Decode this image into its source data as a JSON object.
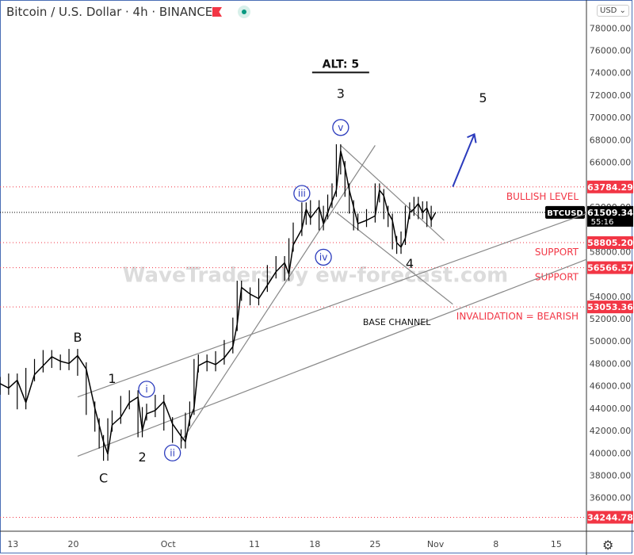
{
  "header": {
    "title": "Bitcoin / U.S. Dollar · 4h · BINANCE",
    "currency": "USD ⌄",
    "settings_icon": "gear-icon"
  },
  "watermark": "WaveTraders by ew-forecast.com",
  "chart_data": {
    "type": "line",
    "title": "Bitcoin / U.S. Dollar · 4h · BINANCE",
    "symbol": "BTCUSD",
    "last_price": "61509.34",
    "countdown": "55:16",
    "ylim": [
      33000,
      80500
    ],
    "yticks": [
      36000,
      38000,
      40000,
      42000,
      44000,
      46000,
      48000,
      50000,
      52000,
      54000,
      58000,
      62000,
      66000,
      68000,
      70000,
      72000,
      74000,
      76000,
      78000
    ],
    "xticks": [
      {
        "label": "13",
        "t": 0
      },
      {
        "label": "20",
        "t": 7
      },
      {
        "label": "Oct",
        "t": 18
      },
      {
        "label": "11",
        "t": 28
      },
      {
        "label": "18",
        "t": 35
      },
      {
        "label": "25",
        "t": 42
      },
      {
        "label": "Nov",
        "t": 49
      },
      {
        "label": "8",
        "t": 56
      },
      {
        "label": "15",
        "t": 63
      }
    ],
    "xlim": [
      -1.5,
      66.5
    ],
    "price_path": [
      [
        -1.5,
        46200
      ],
      [
        -0.5,
        45800
      ],
      [
        0.5,
        46500
      ],
      [
        1.5,
        44500
      ],
      [
        2.5,
        47000
      ],
      [
        3.5,
        47800
      ],
      [
        4.5,
        48600
      ],
      [
        5.5,
        48200
      ],
      [
        6.5,
        48000
      ],
      [
        7.5,
        48700
      ],
      [
        8.5,
        47500
      ],
      [
        9.5,
        44000
      ],
      [
        10,
        42500
      ],
      [
        10.5,
        41000
      ],
      [
        11,
        39900
      ],
      [
        11.5,
        42500
      ],
      [
        12.5,
        43200
      ],
      [
        13.5,
        44500
      ],
      [
        14.5,
        45000
      ],
      [
        15,
        42000
      ],
      [
        15.5,
        43500
      ],
      [
        16.5,
        43800
      ],
      [
        17.5,
        44600
      ],
      [
        18.5,
        42600
      ],
      [
        19.5,
        41500
      ],
      [
        20,
        41000
      ],
      [
        20.5,
        43000
      ],
      [
        21,
        44000
      ],
      [
        21.5,
        47800
      ],
      [
        22.5,
        48200
      ],
      [
        23.5,
        47900
      ],
      [
        24.5,
        48500
      ],
      [
        25.5,
        49500
      ],
      [
        26,
        51500
      ],
      [
        26.5,
        54800
      ],
      [
        27.5,
        54200
      ],
      [
        28.5,
        53800
      ],
      [
        29.5,
        55000
      ],
      [
        30.5,
        56200
      ],
      [
        31.5,
        57000
      ],
      [
        32,
        56000
      ],
      [
        32.5,
        58600
      ],
      [
        33.5,
        60000
      ],
      [
        34,
        61800
      ],
      [
        34.5,
        61000
      ],
      [
        35.5,
        62000
      ],
      [
        36,
        60500
      ],
      [
        36.5,
        61500
      ],
      [
        37,
        62500
      ],
      [
        37.5,
        63500
      ],
      [
        38,
        67000
      ],
      [
        38.5,
        65500
      ],
      [
        39,
        63500
      ],
      [
        39.5,
        62000
      ],
      [
        40,
        60500
      ],
      [
        41,
        60800
      ],
      [
        42,
        61200
      ],
      [
        42.5,
        63500
      ],
      [
        43,
        63000
      ],
      [
        43.5,
        61500
      ],
      [
        44,
        60800
      ],
      [
        44.5,
        58800
      ],
      [
        45,
        58400
      ],
      [
        45.5,
        59200
      ],
      [
        46,
        61500
      ],
      [
        46.5,
        61800
      ],
      [
        47,
        62300
      ],
      [
        47.5,
        61500
      ],
      [
        48,
        61900
      ],
      [
        48.5,
        60800
      ],
      [
        49,
        61500
      ]
    ],
    "levels": [
      {
        "value": 63784.29,
        "label": "BULLISH LEVEL"
      },
      {
        "value": 58805.2,
        "label": "SUPPORT"
      },
      {
        "value": 56566.57,
        "label": "SUPPORT"
      },
      {
        "value": 53053.36,
        "label": "INVALIDATION = BEARISH"
      },
      {
        "value": 34244.78,
        "label": ""
      }
    ],
    "last_price_value": 61509.34,
    "trendlines": [
      {
        "name": "channel-upper",
        "from": [
          7.5,
          45000
        ],
        "to": [
          66.5,
          61400
        ]
      },
      {
        "name": "base-channel",
        "from": [
          7.5,
          39700
        ],
        "to": [
          66.5,
          57300
        ]
      },
      {
        "name": "impulse-line",
        "from": [
          19.5,
          41000
        ],
        "to": [
          42,
          67500
        ]
      },
      {
        "name": "wedge-upper",
        "from": [
          38,
          67500
        ],
        "to": [
          50,
          59000
        ]
      },
      {
        "name": "wedge-lower",
        "from": [
          37.5,
          61500
        ],
        "to": [
          51,
          53300
        ]
      }
    ],
    "wave_labels": [
      {
        "text": "B",
        "t": 7.5,
        "v": 50300,
        "style": "plain"
      },
      {
        "text": "C",
        "t": 10.5,
        "v": 37700,
        "style": "plain"
      },
      {
        "text": "1",
        "t": 11.5,
        "v": 46600,
        "style": "plain"
      },
      {
        "text": "2",
        "t": 15,
        "v": 39600,
        "style": "plain"
      },
      {
        "text": "i",
        "t": 15.5,
        "v": 45700,
        "style": "circle"
      },
      {
        "text": "ii",
        "t": 18.5,
        "v": 40000,
        "style": "circle"
      },
      {
        "text": "iii",
        "t": 33.5,
        "v": 63200,
        "style": "circle"
      },
      {
        "text": "iv",
        "t": 36,
        "v": 57500,
        "style": "circle"
      },
      {
        "text": "v",
        "t": 38,
        "v": 69100,
        "style": "circle"
      },
      {
        "text": "3",
        "t": 38,
        "v": 72100,
        "style": "plain"
      },
      {
        "text": "4",
        "t": 46,
        "v": 56900,
        "style": "plain"
      },
      {
        "text": "5",
        "t": 54.5,
        "v": 71700,
        "style": "plain"
      }
    ],
    "annotations": [
      {
        "text": "ALT: 5",
        "t": 38,
        "v": 74800
      },
      {
        "text": "BASE CHANNEL",
        "t": 44.5,
        "v": 51800
      }
    ],
    "arrow": {
      "from": [
        51,
        63800
      ],
      "to": [
        53.5,
        68500
      ],
      "color": "#2b3bbd"
    },
    "colors": {
      "level": "#f23645",
      "line": "#888888",
      "price": "#000000",
      "wave": "#2b3bbd"
    }
  }
}
